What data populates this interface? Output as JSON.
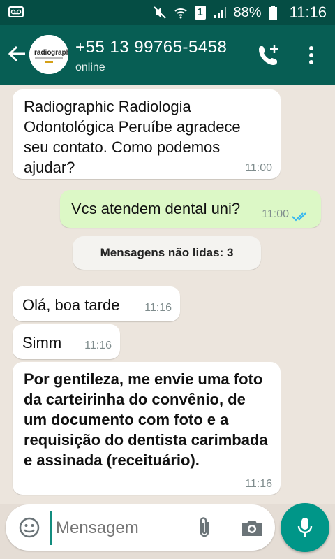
{
  "status_bar": {
    "battery": "88%",
    "time": "11:16",
    "sim": "1"
  },
  "header": {
    "contact_name": "+55 13 99765-5458",
    "contact_status": "online",
    "avatar_text": "radiographic"
  },
  "messages": [
    {
      "direction": "in",
      "text": "Radiographic Radiologia Odontológica Peruíbe agradece seu contato. Como podemos ajudar?",
      "time": "11:00"
    },
    {
      "direction": "out",
      "text": "Vcs atendem dental uni?",
      "time": "11:00"
    },
    {
      "direction": "in",
      "text": "Olá, boa tarde",
      "time": "11:16"
    },
    {
      "direction": "in",
      "text": "Simm",
      "time": "11:16"
    },
    {
      "direction": "in",
      "text": "Por gentileza, me envie uma foto da carteirinha do convênio, de um documento com foto e a requisição do dentista carimbada e assinada (receituário).",
      "time": "11:16"
    }
  ],
  "unread_banner": "Mensagens não lidas: 3",
  "composer": {
    "placeholder": "Mensagem"
  },
  "colors": {
    "header": "#075e54",
    "status_bar": "#054d44",
    "outgoing": "#dcf8c6",
    "accent": "#009688",
    "tick": "#34b7f1"
  }
}
